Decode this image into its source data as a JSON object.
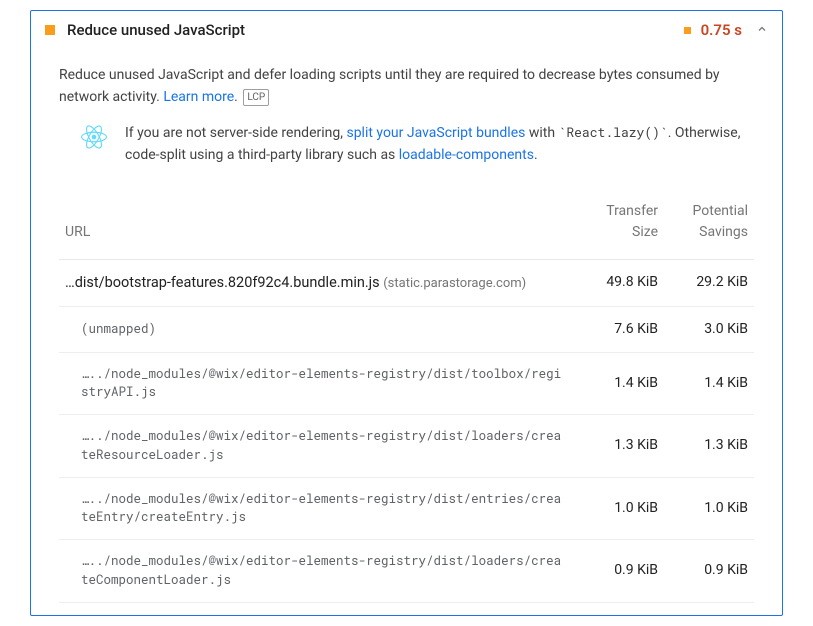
{
  "audit": {
    "title": "Reduce unused JavaScript",
    "displayValue": "0.75 s",
    "description_prefix": "Reduce unused JavaScript and defer loading scripts until they are required to decrease bytes consumed by network activity. ",
    "learn_more": "Learn more",
    "lcp_badge": "LCP",
    "stackpack": {
      "prefix": "If you are not server-side rendering, ",
      "link1": "split your JavaScript bundles",
      "mid": " with `React.lazy()`. Otherwise, code-split using a third-party library such as ",
      "link2": "loadable-components",
      "suffix": "."
    },
    "columns": {
      "url": "URL",
      "transfer": "Transfer Size",
      "savings": "Potential Savings"
    },
    "rows": [
      {
        "kind": "bundle",
        "path": "…dist/bootstrap-features.820f92c4.bundle.min.js",
        "domain": "(static.parastorage.com)",
        "transfer": "49.8 KiB",
        "savings": "29.2 KiB"
      },
      {
        "kind": "sub",
        "path": "(unmapped)",
        "transfer": "7.6 KiB",
        "savings": "3.0 KiB"
      },
      {
        "kind": "sub",
        "path": "…../node_modules/@wix/editor-elements-registry/dist/toolbox/registryAPI.js",
        "transfer": "1.4 KiB",
        "savings": "1.4 KiB"
      },
      {
        "kind": "sub",
        "path": "…../node_modules/@wix/editor-elements-registry/dist/loaders/createResourceLoader.js",
        "transfer": "1.3 KiB",
        "savings": "1.3 KiB"
      },
      {
        "kind": "sub",
        "path": "…../node_modules/@wix/editor-elements-registry/dist/entries/createEntry/createEntry.js",
        "transfer": "1.0 KiB",
        "savings": "1.0 KiB"
      },
      {
        "kind": "sub",
        "path": "…../node_modules/@wix/editor-elements-registry/dist/loaders/createComponentLoader.js",
        "transfer": "0.9 KiB",
        "savings": "0.9 KiB"
      }
    ]
  }
}
